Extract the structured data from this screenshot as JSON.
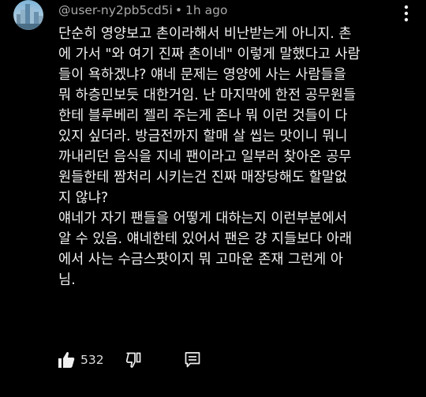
{
  "comment": {
    "author": "@user-ny2pb5cd5i",
    "separator": "•",
    "time": "1h ago",
    "text_lines": [
      "단순히 영양보고 촌이라해서 비난받는게 아니지. 촌",
      "에 가서 \"와 여기 진짜 촌이네\" 이렇게 말했다고 사람",
      "들이 욕하겠냐? 얘네 문제는 영양에 사는 사람들을",
      "뭐 하층민보듯 대한거임. 난 마지막에 한전 공무원들",
      "한테 블루베리 젤리 주는게 존나 뭐 이런 것들이 다",
      "있지 싶더라. 방금전까지 할매 살 씹는 맛이니 뭐니",
      "까내리던 음식을 지네 팬이라고 일부러 찾아온 공무",
      "원들한테 짬처리 시키는건 진짜 매장당해도 할말없",
      "지 않냐?",
      "얘네가 자기 팬들을 어떻게 대하는지 이런부분에서",
      "알 수 있음. 얘네한테 있어서 팬은 걍 지들보다 아래",
      "에서 사는 수금스팟이지 뭐 고마운 존재 그런게  아",
      "님."
    ],
    "like_count": "532"
  },
  "icons": {
    "avatar": "city-skyline-avatar",
    "menu": "more-vert-icon",
    "like": "thumbs-up-filled-icon",
    "dislike": "thumbs-down-outline-icon",
    "reply": "comment-reply-icon"
  },
  "colors": {
    "background": "#000000",
    "text": "#f1f1f1",
    "meta": "#aaaaaa"
  }
}
